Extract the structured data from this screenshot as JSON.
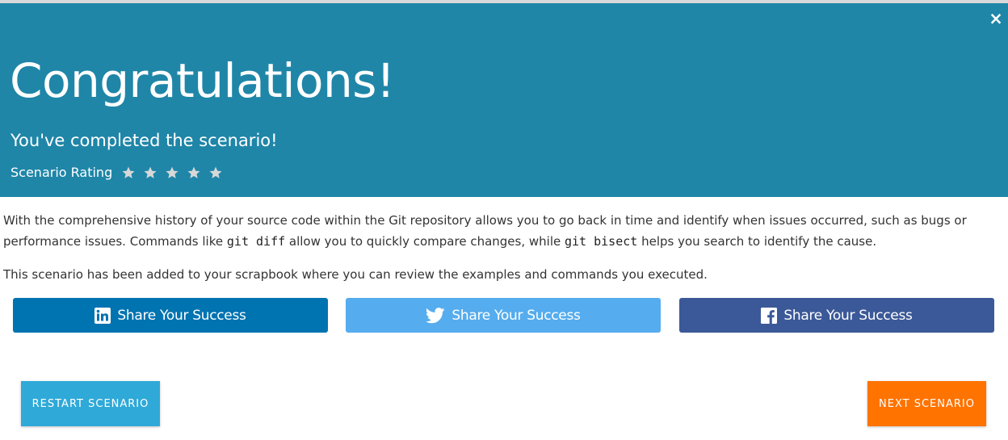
{
  "modal": {
    "close_symbol": "×",
    "title": "Congratulations!",
    "subtitle": "You've completed the scenario!",
    "rating_label": "Scenario Rating",
    "rating_stars": 5,
    "banner_color": "#1f86a8"
  },
  "summary": {
    "part1": "With the comprehensive history of your source code within the Git repository allows you to go back in time and identify when issues occurred, such as bugs or performance issues. Commands like ",
    "code1": "git diff",
    "part2": " allow you to quickly compare changes, while ",
    "code2": "git bisect",
    "part3": " helps you search to identify the cause.",
    "scrapbook": "This scenario has been added to your scrapbook where you can review the examples and commands you executed."
  },
  "share": {
    "linkedin": {
      "label": "Share Your Success",
      "icon": "linkedin-icon",
      "color": "#0073b1"
    },
    "twitter": {
      "label": "Share Your Success",
      "icon": "twitter-icon",
      "color": "#55acee"
    },
    "facebook": {
      "label": "Share Your Success",
      "icon": "facebook-icon",
      "color": "#3b5998"
    }
  },
  "actions": {
    "restart": "RESTART SCENARIO",
    "next": "NEXT SCENARIO",
    "restart_color": "#2fa9d8",
    "next_color": "#ff7300"
  }
}
